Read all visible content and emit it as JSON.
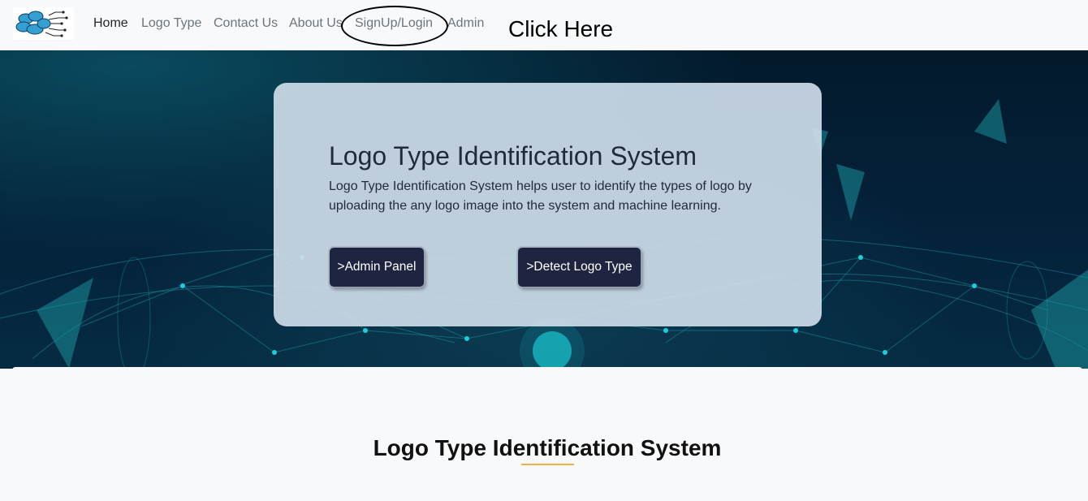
{
  "nav": {
    "items": [
      {
        "label": "Home"
      },
      {
        "label": "Logo Type"
      },
      {
        "label": "Contact Us"
      },
      {
        "label": "About Us"
      },
      {
        "label": "SignUp/Login"
      },
      {
        "label": "Admin"
      }
    ],
    "annotation": "Click Here"
  },
  "hero": {
    "title": "Logo Type Identification System",
    "description": "Logo Type Identification System helps user to identify the types of logo by uploading the any logo image into the system and machine learning.",
    "buttons": {
      "admin": ">Admin Panel",
      "detect": ">Detect Logo Type"
    }
  },
  "section": {
    "title": "Logo Type Identification System"
  },
  "colors": {
    "button_bg": "#1f2540",
    "card_bg": "#cedce8",
    "underline": "#f0b040",
    "hero_bg": "#031a2c"
  }
}
